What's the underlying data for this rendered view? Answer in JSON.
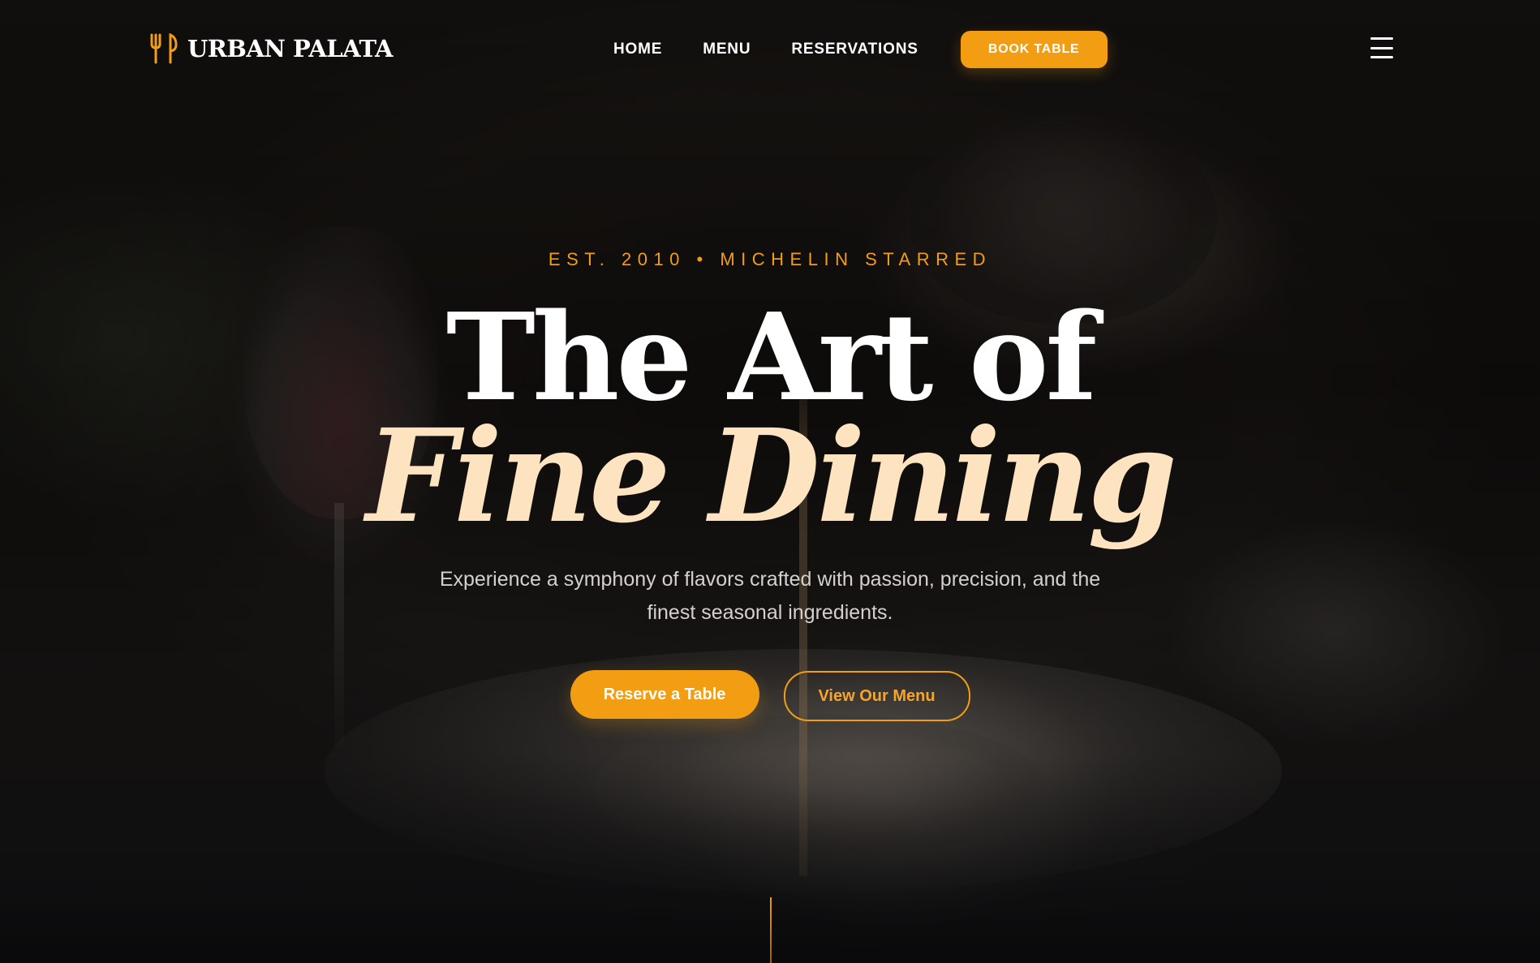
{
  "brand": {
    "name": "URBAN PALATA",
    "icon": "fork-spoon-icon",
    "accent_color": "#f29d12"
  },
  "nav": {
    "links": [
      "HOME",
      "MENU",
      "RESERVATIONS"
    ],
    "book_label": "BOOK TABLE",
    "menu_icon": "hamburger-icon"
  },
  "hero": {
    "eyebrow": "EST. 2010 • MICHELIN STARRED",
    "headline_line1": "The Art of",
    "headline_line2": "Fine Dining",
    "subtitle": "Experience a symphony of flavors crafted with passion, precision, and the finest seasonal ingredients.",
    "primary_cta": "Reserve a Table",
    "secondary_cta": "View Our Menu"
  }
}
